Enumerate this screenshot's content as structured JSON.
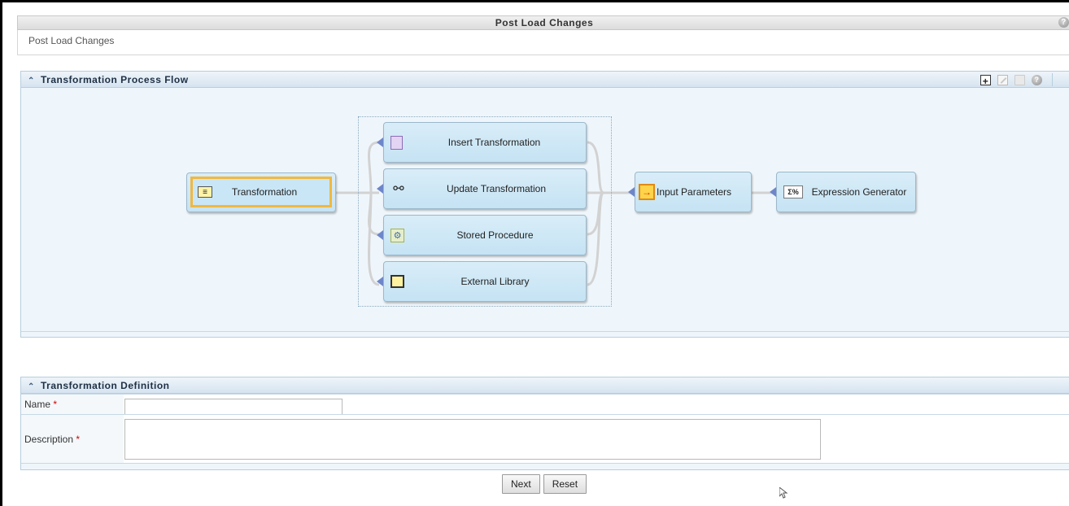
{
  "page": {
    "title": "Post Load Changes",
    "breadcrumb": "Post Load Changes",
    "help_icon": "help-icon"
  },
  "flow": {
    "title": "Transformation Process Flow",
    "toolbar": [
      "add-icon",
      "edit-icon",
      "delete-icon",
      "help-icon"
    ],
    "nodes": {
      "transformation": "Transformation",
      "insert": "Insert Transformation",
      "update": "Update Transformation",
      "stored": "Stored Procedure",
      "external": "External Library",
      "input": "Input Parameters",
      "expression": "Expression Generator"
    },
    "icon_text": {
      "expression": "Σ%"
    },
    "colors": {
      "node_fill": "#c5e3f4",
      "selected_border": "#f0b840",
      "pin": "#6e86c9"
    }
  },
  "definition": {
    "title": "Transformation Definition",
    "name_label": "Name",
    "description_label": "Description",
    "required_mark": "*",
    "name_value": "",
    "description_value": ""
  },
  "buttons": {
    "next": "Next",
    "reset": "Reset"
  }
}
